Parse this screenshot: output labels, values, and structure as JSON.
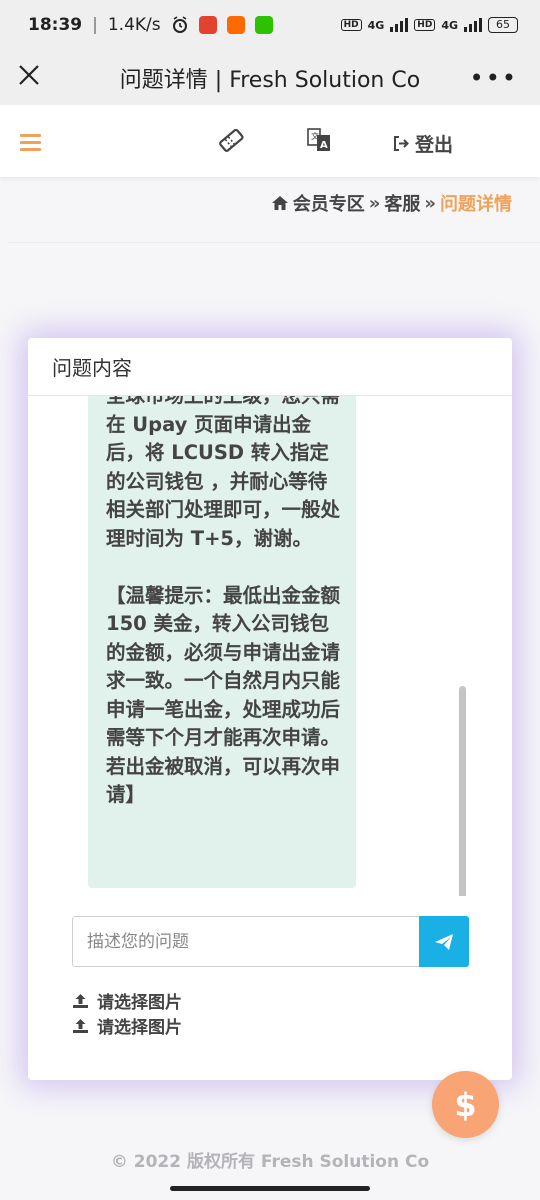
{
  "status_bar": {
    "time": "18:39",
    "speed": "1.4K/s",
    "network1": "4G",
    "network2": "4G",
    "hd1": "HD",
    "hd2": "HD",
    "battery": "65"
  },
  "window": {
    "title": "问题详情 | Fresh Solution Co"
  },
  "navbar": {
    "logout_label": "登出"
  },
  "breadcrumb": {
    "home": "会员专区",
    "sep1": "»",
    "parent": "客服",
    "sep2": "»",
    "current": "问题详情"
  },
  "card": {
    "header": "问题内容",
    "message": "全球市场上的上级，您只需在 Upay 页面申请出金后，将 LCUSD 转入指定的公司钱包 ，并耐心等待相关部门处理即可，一般处理时间为 T+5，谢谢。\n\n【温馨提示：最低出金金额 150 美金，转入公司钱包的金额，必须与申请出金请求一致。一个自然月内只能申请一笔出金，处理成功后需等下个月才能再次申请。若出金被取消，可以再次申请】",
    "input_placeholder": "描述您的问题",
    "upload1": "请选择图片",
    "upload2": "请选择图片"
  },
  "fab_symbol": "$",
  "footer": "© 2022 版权所有 Fresh Solution Co",
  "colors": {
    "accent": "#f0a25a",
    "send": "#1ab0e6",
    "bubble": "#e1f1ec",
    "fab": "#f8a474"
  }
}
